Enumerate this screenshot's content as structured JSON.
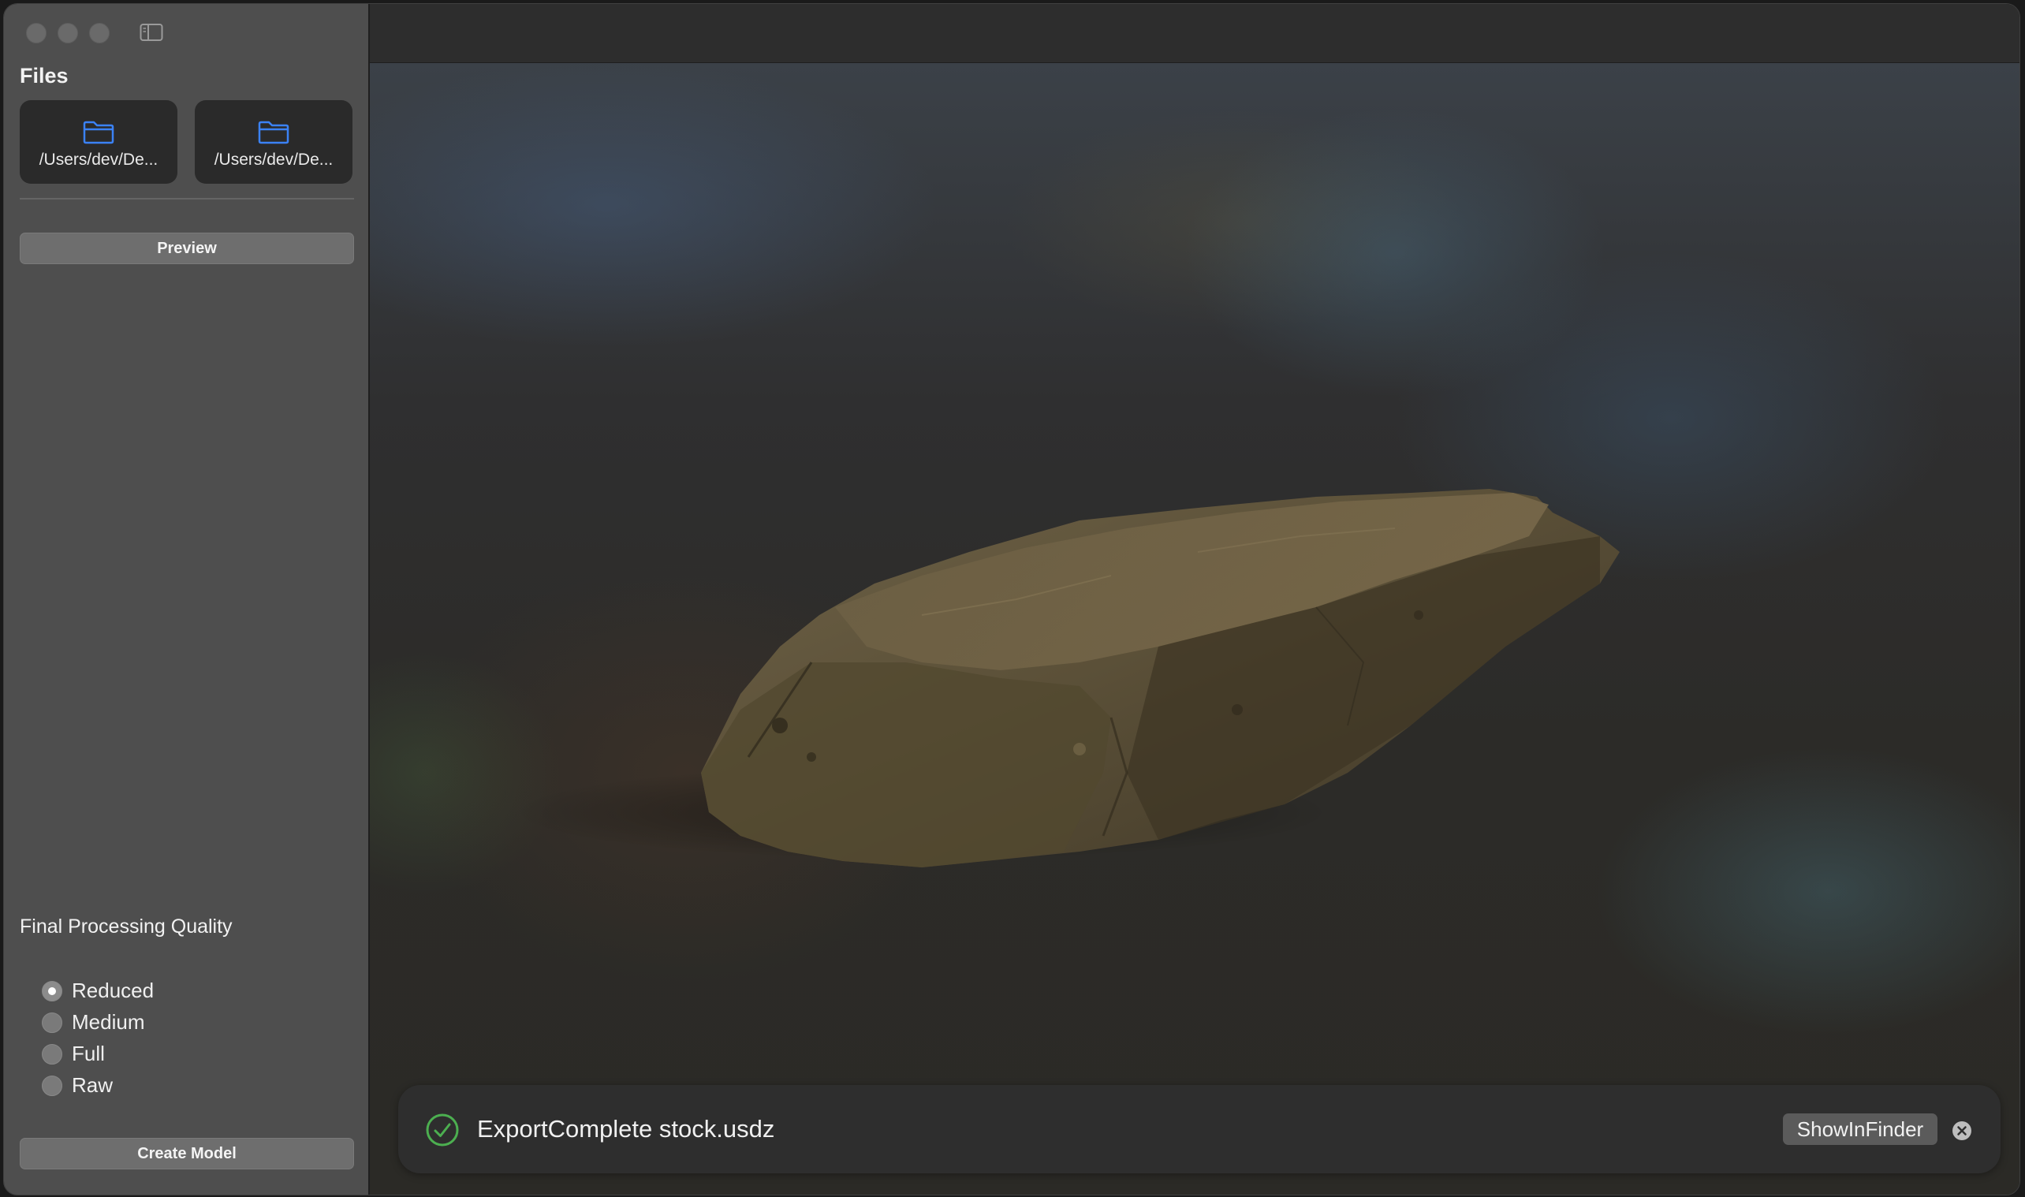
{
  "sidebar": {
    "title": "Files",
    "file_cards": [
      {
        "path": "/Users/dev/De...",
        "icon": "folder-icon"
      },
      {
        "path": "/Users/dev/De...",
        "icon": "folder-icon"
      }
    ],
    "preview_label": "Preview",
    "quality": {
      "title": "Final Processing Quality",
      "options": [
        "Reduced",
        "Medium",
        "Full",
        "Raw"
      ],
      "selected": "Reduced"
    },
    "create_label": "Create Model"
  },
  "toast": {
    "message": "ExportComplete stock.usdz",
    "button_label": "ShowInFinder",
    "icon": "checkmark-circle-icon",
    "icon_color": "#4caf50"
  },
  "colors": {
    "accent": "#3b82f6",
    "success": "#4caf50"
  }
}
